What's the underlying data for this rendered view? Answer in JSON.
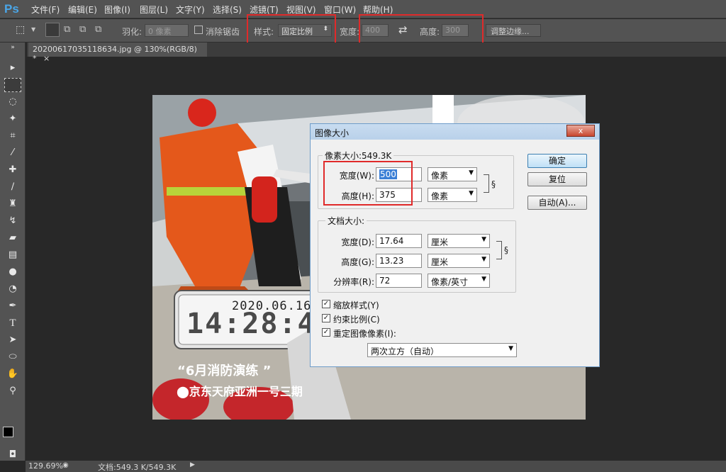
{
  "app": {
    "logo": "Ps"
  },
  "menu": [
    "文件(F)",
    "编辑(E)",
    "图像(I)",
    "图层(L)",
    "文字(Y)",
    "选择(S)",
    "滤镜(T)",
    "视图(V)",
    "窗口(W)",
    "帮助(H)"
  ],
  "options": {
    "feather_label": "羽化:",
    "feather_value": "0 像素",
    "antialias_label": "消除锯齿",
    "style_label": "样式:",
    "style_value": "固定比例",
    "width_label": "宽度:",
    "width_value": "400",
    "height_label": "高度:",
    "height_value": "300",
    "refine_label": "调整边缘..."
  },
  "document": {
    "tab_title": "20200617035118634.jpg @ 130%(RGB/8) *",
    "close": "×"
  },
  "photo": {
    "date": "2020.06.16",
    "time": "14:28:4",
    "caption": "“6月消防演练 ”",
    "location": "京东天府亚洲一号三期"
  },
  "status": {
    "zoom": "129.69%",
    "doc": "文档:549.3 K/549.3K"
  },
  "dialog": {
    "title": "图像大小",
    "close": "x",
    "pixel_group": "像素大小:549.3K",
    "px_width_label": "宽度(W):",
    "px_width_value": "500",
    "px_width_unit": "像素",
    "px_height_label": "高度(H):",
    "px_height_value": "375",
    "px_height_unit": "像素",
    "doc_group": "文档大小:",
    "doc_width_label": "宽度(D):",
    "doc_width_value": "17.64",
    "doc_width_unit": "厘米",
    "doc_height_label": "高度(G):",
    "doc_height_value": "13.23",
    "doc_height_unit": "厘米",
    "res_label": "分辨率(R):",
    "res_value": "72",
    "res_unit": "像素/英寸",
    "scale_styles": "缩放样式(Y)",
    "constrain": "约束比例(C)",
    "resample": "重定图像像素(I):",
    "resample_method": "两次立方（自动）",
    "ok": "确定",
    "reset": "复位",
    "auto": "自动(A)..."
  },
  "colors": {
    "accent": "#3b7fd6",
    "highlight_box": "#e02a2a",
    "ps_blue": "#4aa6e8"
  }
}
